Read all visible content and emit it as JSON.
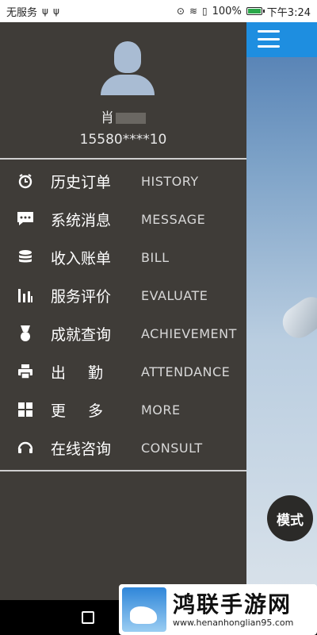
{
  "status_bar": {
    "carrier": "无服务",
    "usb_icons": [
      "usb-icon",
      "usb-icon"
    ],
    "icons": [
      "location-icon",
      "wifi-icon",
      "sim-icon"
    ],
    "battery_percent": "100%",
    "time": "下午3:24"
  },
  "drawer": {
    "user": {
      "name": "肖",
      "phone": "15580****10"
    },
    "menu": [
      {
        "label": "历史订单",
        "en": "HISTORY",
        "icon": "history-icon"
      },
      {
        "label": "系统消息",
        "en": "MESSAGE",
        "icon": "message-icon"
      },
      {
        "label": "收入账单",
        "en": "BILL",
        "icon": "coins-icon"
      },
      {
        "label": "服务评价",
        "en": "EVALUATE",
        "icon": "bar-chart-icon"
      },
      {
        "label": "成就查询",
        "en": "ACHIEVEMENT",
        "icon": "medal-icon"
      },
      {
        "label": "出勤",
        "en": "ATTENDANCE",
        "icon": "printer-icon"
      },
      {
        "label": "更多",
        "en": "MORE",
        "icon": "grid-icon"
      },
      {
        "label": "在线咨询",
        "en": "CONSULT",
        "icon": "headset-icon"
      }
    ]
  },
  "main": {
    "mode_button": "模式"
  },
  "watermark": {
    "title": "鸿联手游网",
    "url": "www.henanhonglian95.com"
  },
  "colors": {
    "drawer_bg": "#3f3c38",
    "topbar": "#1e8ee0",
    "battery": "#2aa84a"
  }
}
